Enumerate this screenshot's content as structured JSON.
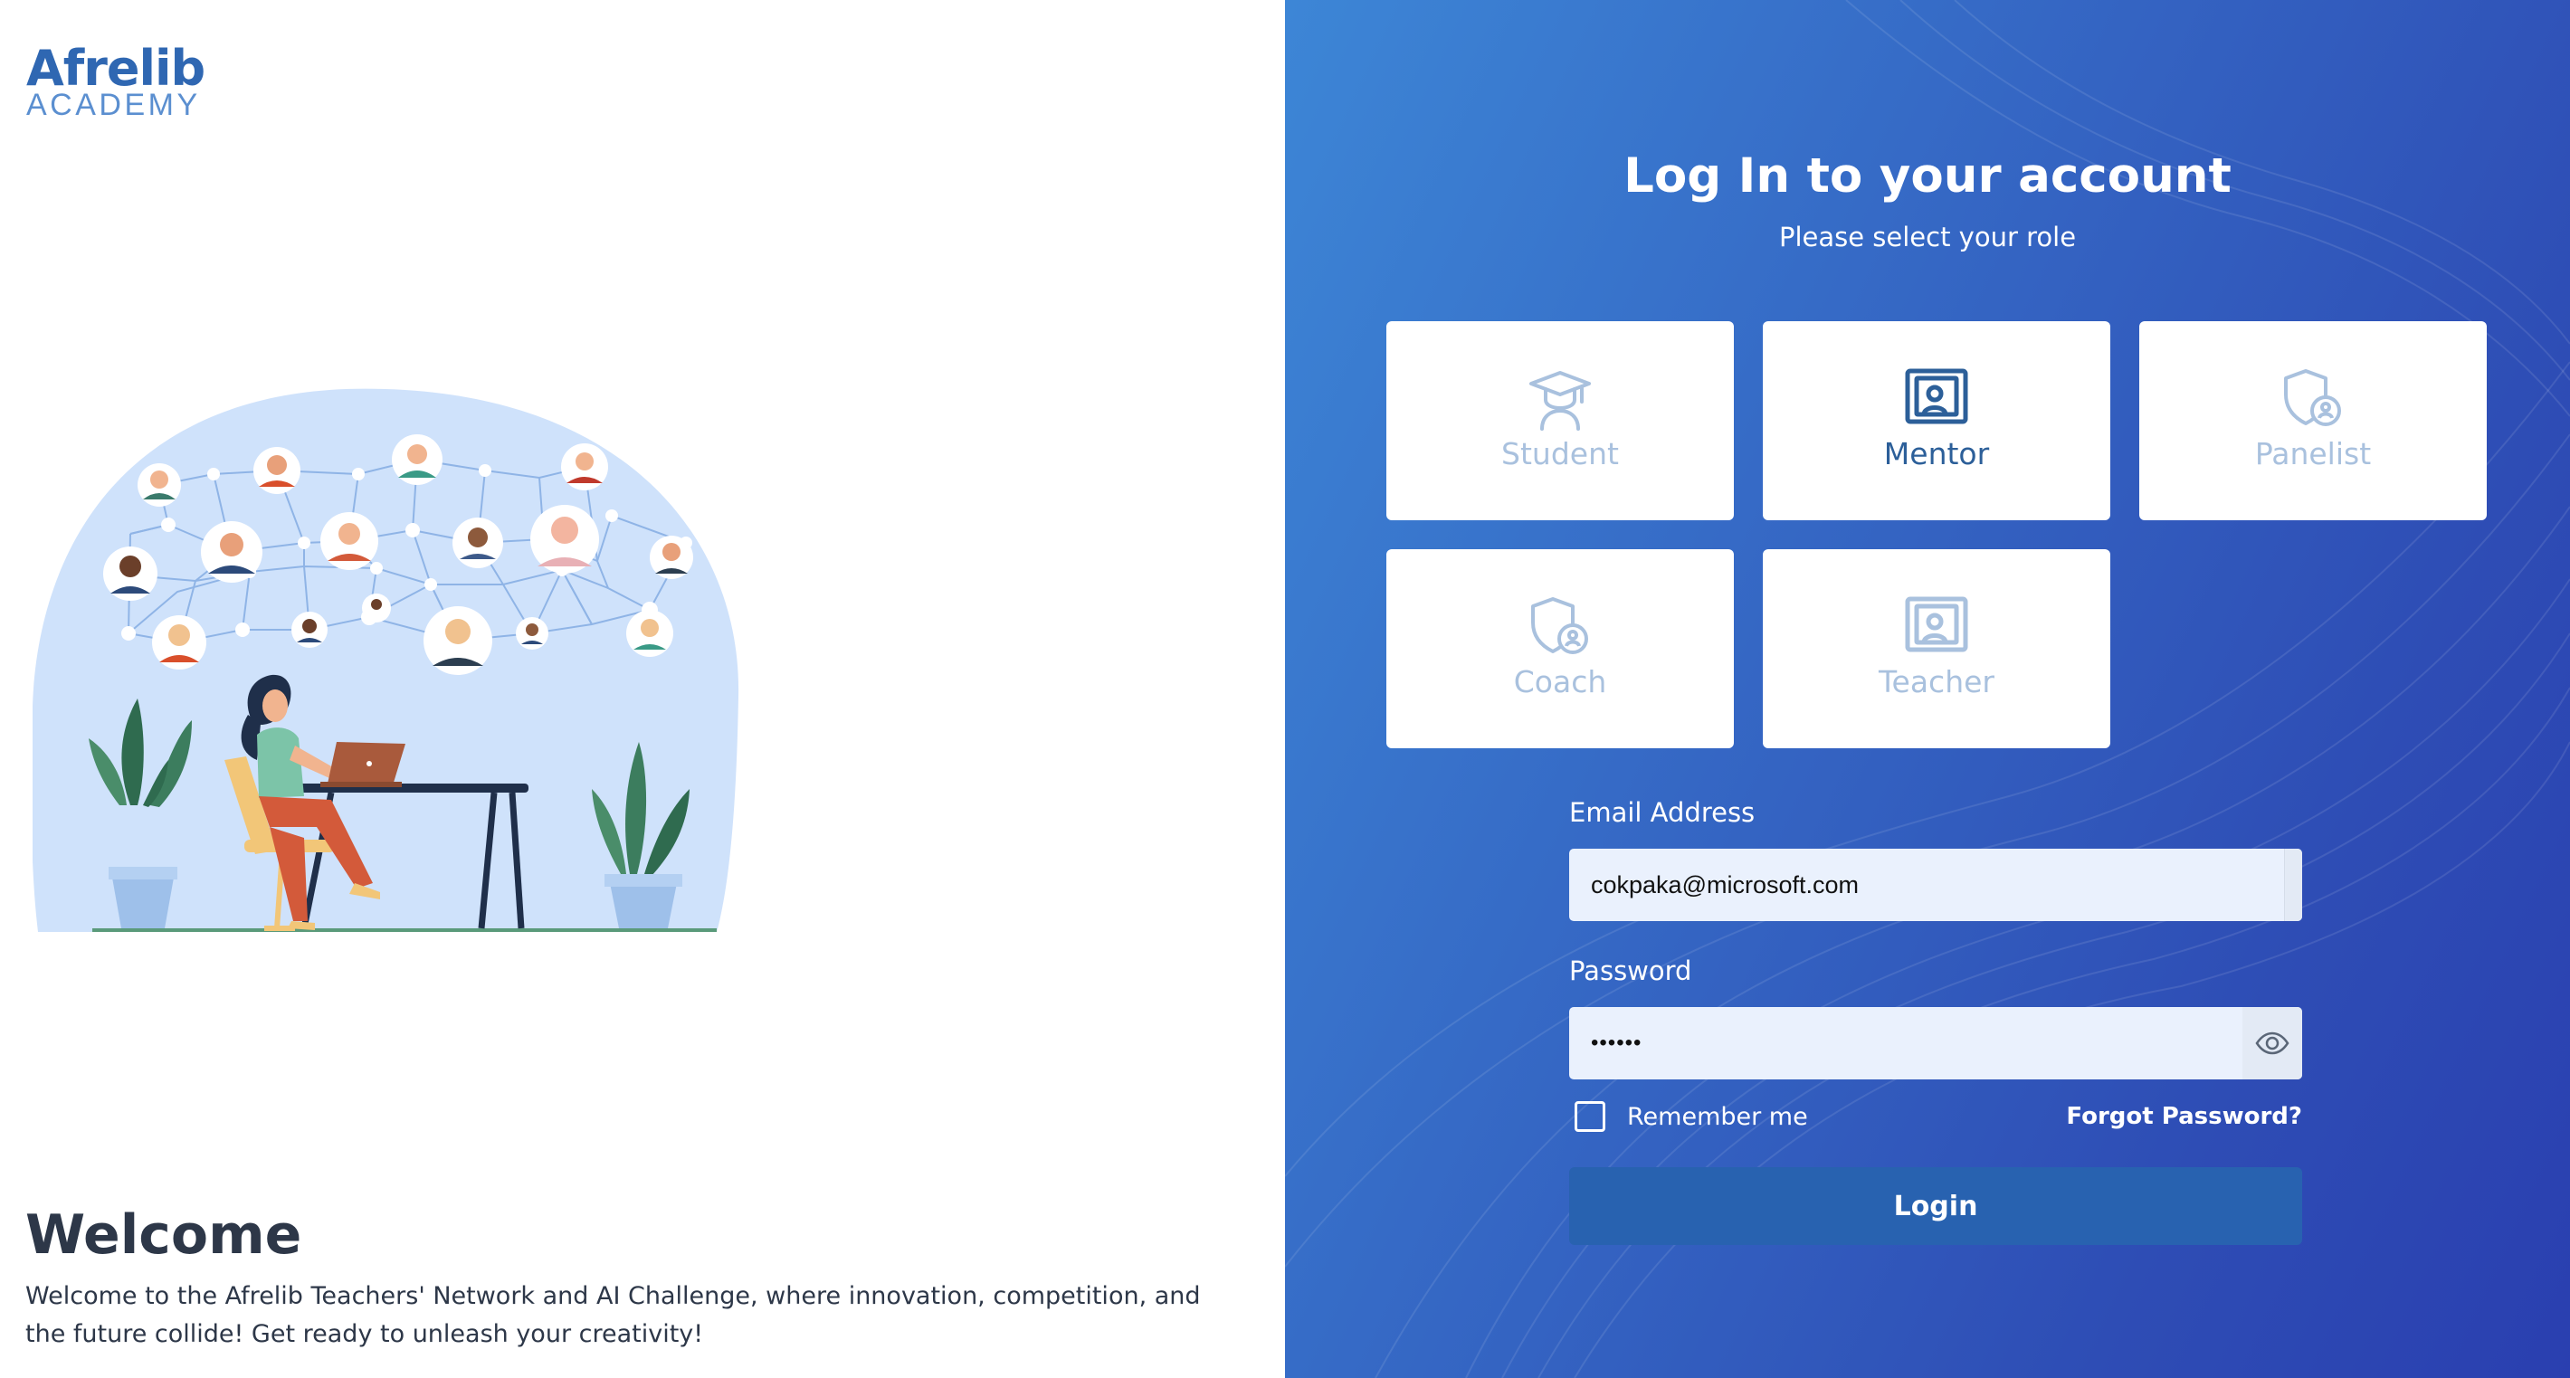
{
  "brand": {
    "name": "Afrelib",
    "sub": "ACADEMY"
  },
  "welcome": {
    "title": "Welcome",
    "text": "Welcome to the Afrelib Teachers' Network and AI Challenge, where innovation, competition, and the future collide! Get ready to unleash your creativity!"
  },
  "login": {
    "title": "Log In to your account",
    "subtitle": "Please select your role",
    "roles": [
      {
        "label": "Student",
        "icon": "graduation-cap-icon",
        "selected": false
      },
      {
        "label": "Mentor",
        "icon": "presentation-board-icon",
        "selected": true
      },
      {
        "label": "Panelist",
        "icon": "shield-user-icon",
        "selected": false
      },
      {
        "label": "Coach",
        "icon": "shield-user-icon",
        "selected": false
      },
      {
        "label": "Teacher",
        "icon": "presentation-board-icon",
        "selected": false
      }
    ],
    "email": {
      "label": "Email Address",
      "value": "cokpaka@microsoft.com"
    },
    "password": {
      "label": "Password",
      "value": "••••••"
    },
    "remember_label": "Remember me",
    "forgot_label": "Forgot Password?",
    "login_label": "Login"
  },
  "colors": {
    "accent": "#2862b0",
    "panel_gradient_start": "#3d86d6",
    "panel_gradient_end": "#2a3fb0",
    "role_selected": "#2c5f99",
    "role_unselected": "#a9c1de",
    "text_dark": "#2d3748"
  }
}
